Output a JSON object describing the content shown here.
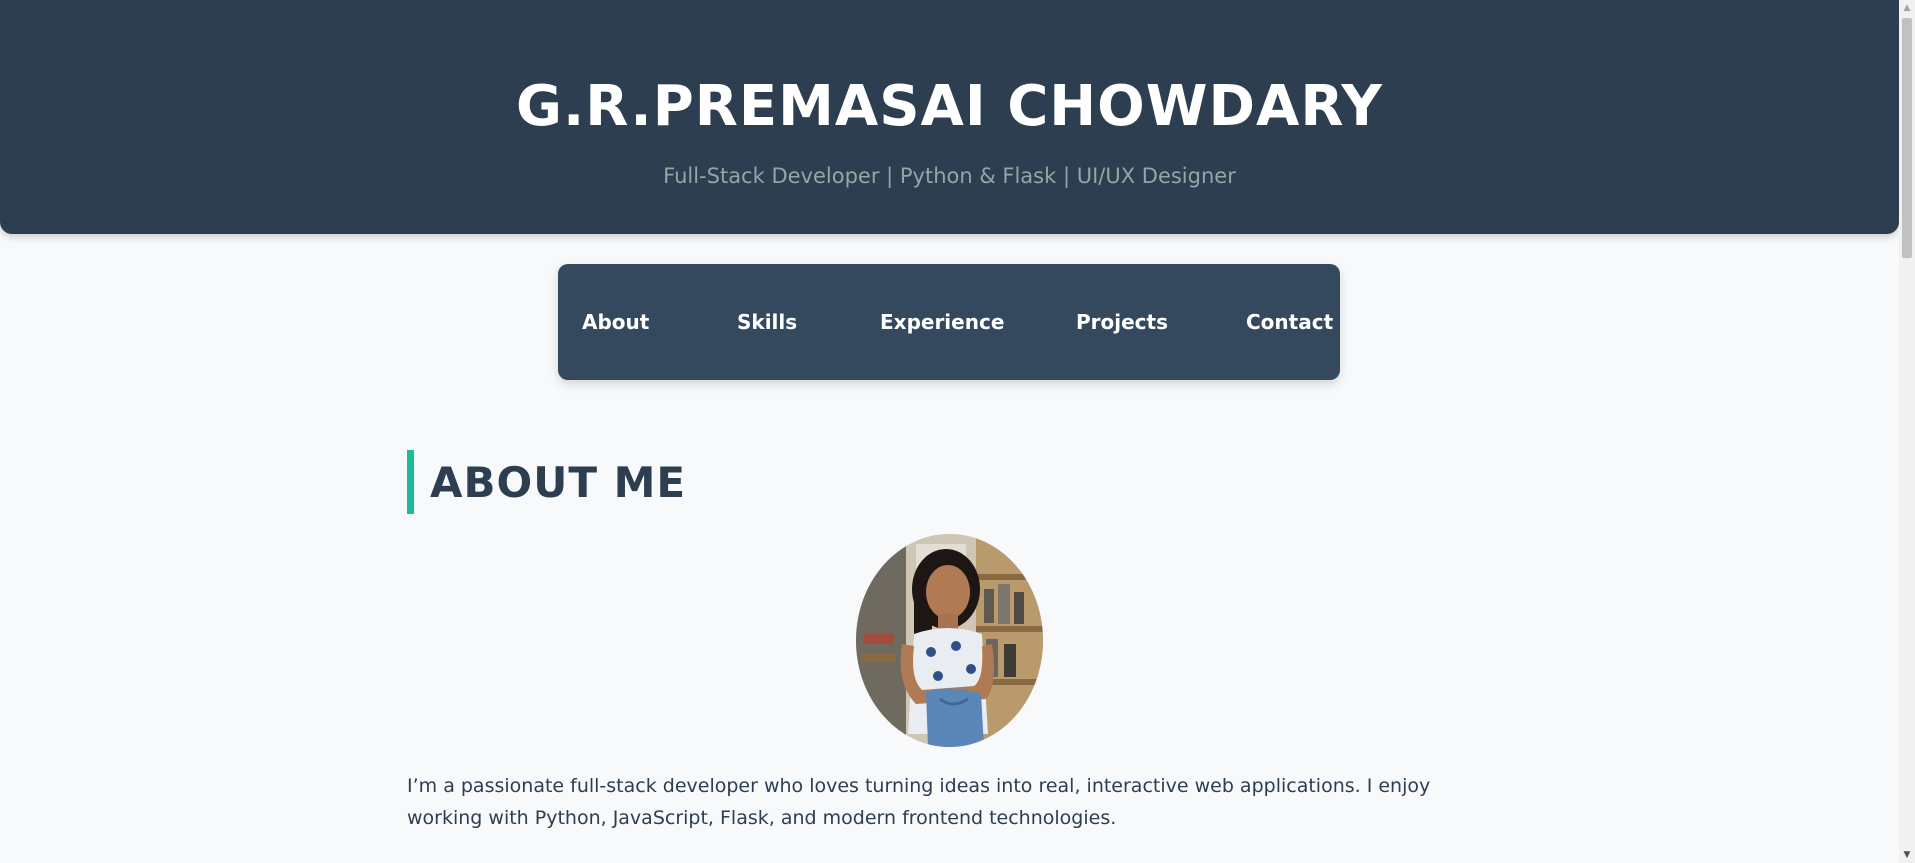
{
  "header": {
    "name": "G.R.PREMASAI CHOWDARY",
    "tagline": "Full-Stack Developer | Python & Flask | UI/UX Designer"
  },
  "nav": {
    "items": [
      {
        "label": "About"
      },
      {
        "label": "Skills"
      },
      {
        "label": "Experience"
      },
      {
        "label": "Projects"
      },
      {
        "label": "Contact"
      }
    ]
  },
  "about": {
    "heading": "ABOUT ME",
    "photo_icon": "profile-photo",
    "paragraph": "I’m a passionate full-stack developer who loves turning ideas into real, interactive web applications. I enjoy working with Python, JavaScript, Flask, and modern frontend technologies."
  },
  "colors": {
    "header_bg": "#2c3e50",
    "nav_bg": "#34495e",
    "accent": "#1abc9c",
    "page_bg": "#f7f9fb",
    "subtitle": "#95a5a6"
  }
}
